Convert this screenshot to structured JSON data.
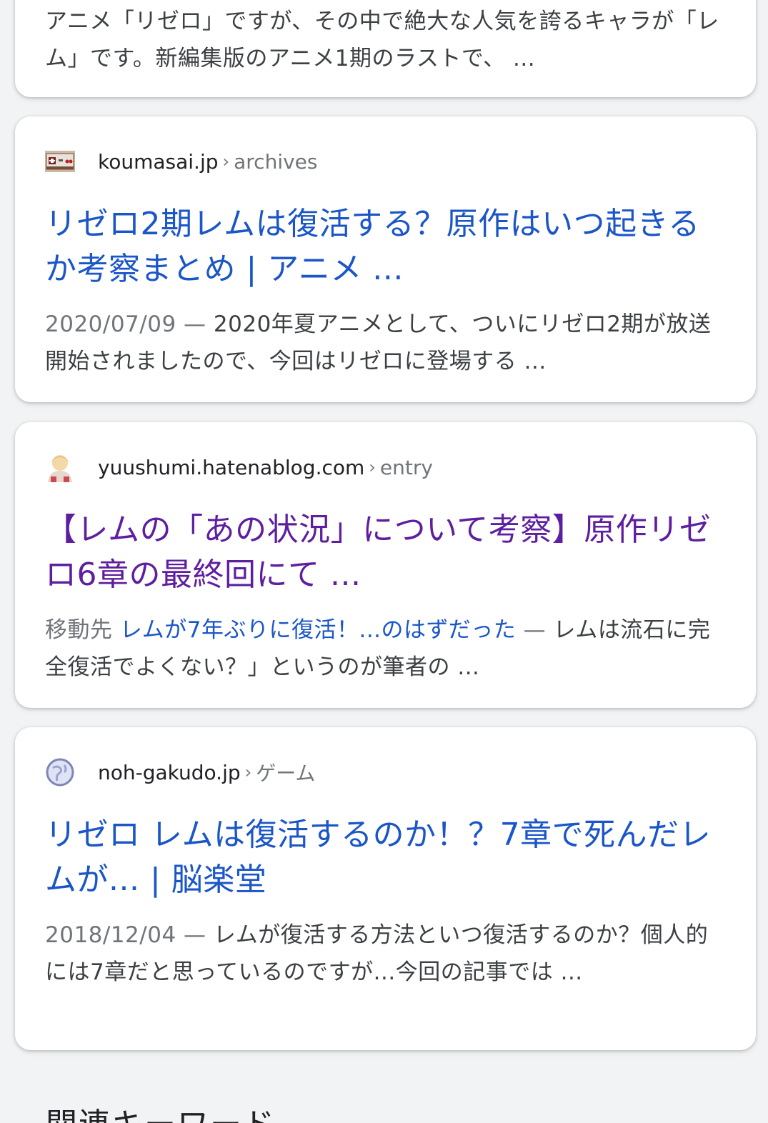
{
  "results": [
    {
      "snippet_text": "アニメ「リゼロ」ですが、その中で絶大な人気を誇るキャラが「レム」です。新編集版のアニメ1期のラストで、 ..."
    },
    {
      "favicon": "game-controller-icon",
      "domain": "koumasai.jp",
      "separator": "›",
      "path": "archives",
      "title": "リゼロ2期レムは復活する？原作はいつ起きるか考察まとめ | アニメ ...",
      "date": "2020/07/09",
      "dash": "—",
      "snippet": "2020年夏アニメとして、ついにリゼロ2期が放送開始されましたので、今回はリゼロに登場する ..."
    },
    {
      "favicon": "avatar-icon",
      "domain": "yuushumi.hatenablog.com",
      "separator": "›",
      "path": "entry",
      "title": "【レムの「あの状況」について考察】原作リゼロ6章の最終回にて ...",
      "jump_prefix": "移動先",
      "jump_link": "レムが7年ぶりに復活！...のはずだった",
      "dash": "—",
      "snippet": "レムは流石に完全復活でよくない？」というのが筆者の ..."
    },
    {
      "favicon": "globe-icon",
      "domain": "noh-gakudo.jp",
      "separator": "›",
      "path": "ゲーム",
      "title": "リゼロ レムは復活するのか！？7章で死んだレムが... | 脳楽堂",
      "date": "2018/12/04",
      "dash": "—",
      "snippet": "レムが復活する方法といつ復活するのか？個人的には7章だと思っているのですが...今回の記事では ..."
    }
  ],
  "related_heading": "関連キーワード",
  "colors": {
    "link": "#1a56c8",
    "visited": "#5e1ea0",
    "text": "#3c4043",
    "meta": "#70757a",
    "background": "#f1f3f4"
  }
}
